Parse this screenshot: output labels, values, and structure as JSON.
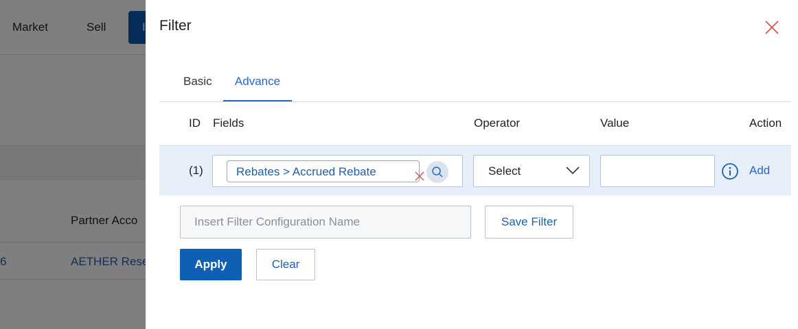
{
  "background": {
    "nav": [
      "Market",
      "Sell"
    ],
    "nav_active_label": "I",
    "table_header_fragment": "Partner Acco",
    "row_number_fragment": "6",
    "row_link_fragment": "AETHER Rese"
  },
  "drawer": {
    "title": "Filter",
    "tabs": [
      {
        "label": "Basic",
        "active": false
      },
      {
        "label": "Advance",
        "active": true
      }
    ],
    "columns": {
      "id": "ID",
      "fields": "Fields",
      "operator": "Operator",
      "value": "Value",
      "action": "Action"
    },
    "rule": {
      "id": "(1)",
      "field_chip": "Rebates > Accrued Rebate",
      "operator": "Select",
      "value": "",
      "action_label": "Add"
    },
    "config_name": {
      "value": "",
      "placeholder": "Insert Filter Configuration Name"
    },
    "buttons": {
      "save_filter": "Save Filter",
      "apply": "Apply",
      "clear": "Clear"
    }
  },
  "colors": {
    "accent": "#2a66c4",
    "primary_button": "#0f5fb4",
    "row_highlight": "#e7effa",
    "close_icon": "#d9534f",
    "overlay": "rgba(0,0,0,0.5)"
  },
  "icons": {
    "close": "close-icon",
    "chip_remove": "close-icon",
    "search": "search-icon",
    "operator_dropdown": "chevron-down-icon",
    "info": "info-icon"
  }
}
